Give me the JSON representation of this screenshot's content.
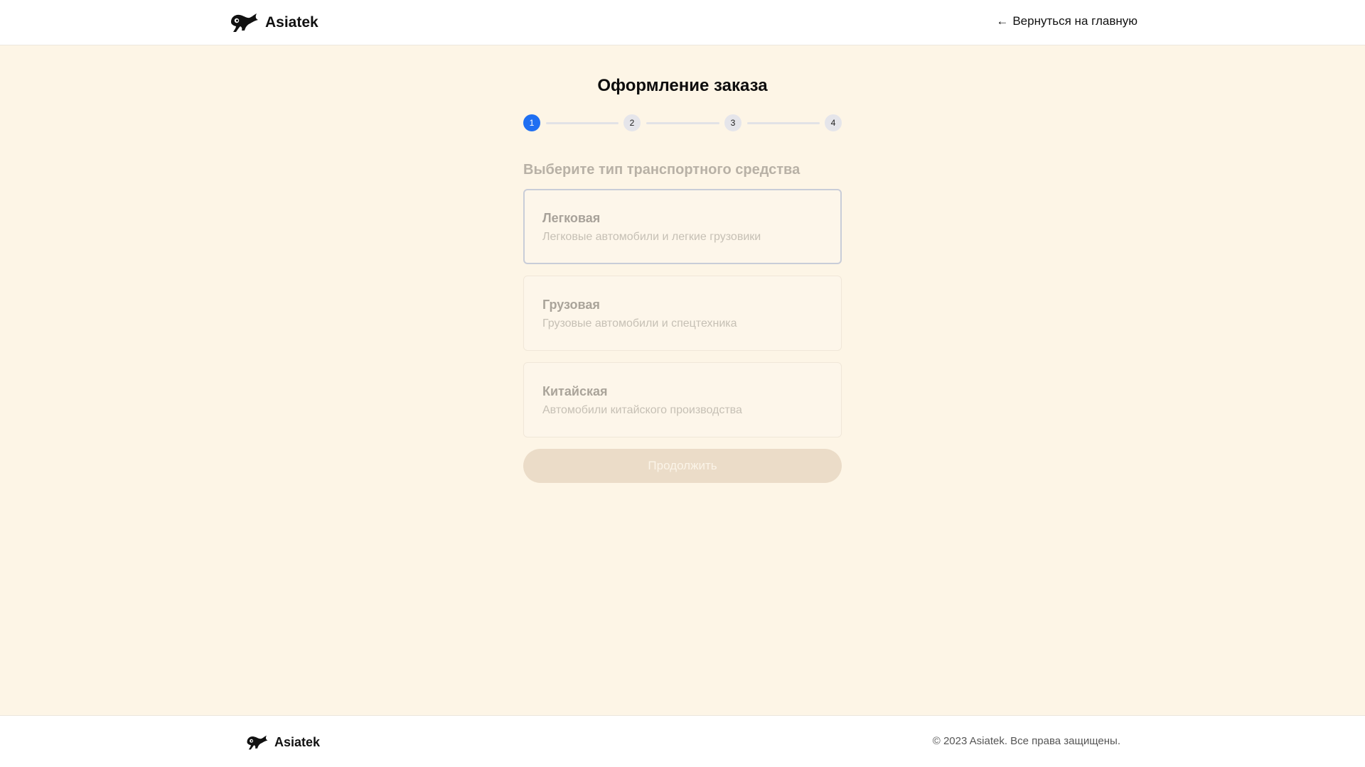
{
  "colors": {
    "page_background": "#fdf5e6",
    "accent_active_step": "#1f6ff2",
    "inactive_step": "#e5e5ea",
    "disabled_button": "#ebdcc8"
  },
  "header": {
    "logo_icon": "chameleon-logo-icon",
    "brand_name": "Asiatek",
    "back_link": {
      "icon": "arrow-left-icon",
      "label": "Вернуться на главную"
    }
  },
  "main": {
    "title": "Оформление заказа",
    "stepper": {
      "current_step": 1,
      "steps": [
        {
          "label": "1"
        },
        {
          "label": "2"
        },
        {
          "label": "3"
        },
        {
          "label": "4"
        }
      ]
    },
    "section_label": "Выберите тип транспортного средства",
    "options": [
      {
        "title": "Легковая",
        "description": "Легковые автомобили и легкие грузовики",
        "selected": true
      },
      {
        "title": "Грузовая",
        "description": "Грузовые автомобили и спецтехника",
        "selected": false
      },
      {
        "title": "Китайская",
        "description": "Автомобили китайского производства",
        "selected": false
      }
    ],
    "continue_button": {
      "label": "Продолжить",
      "disabled": true
    }
  },
  "footer": {
    "logo_icon": "chameleon-logo-icon",
    "brand_name": "Asiatek",
    "copyright": "© 2023 Asiatek. Все права защищены."
  }
}
